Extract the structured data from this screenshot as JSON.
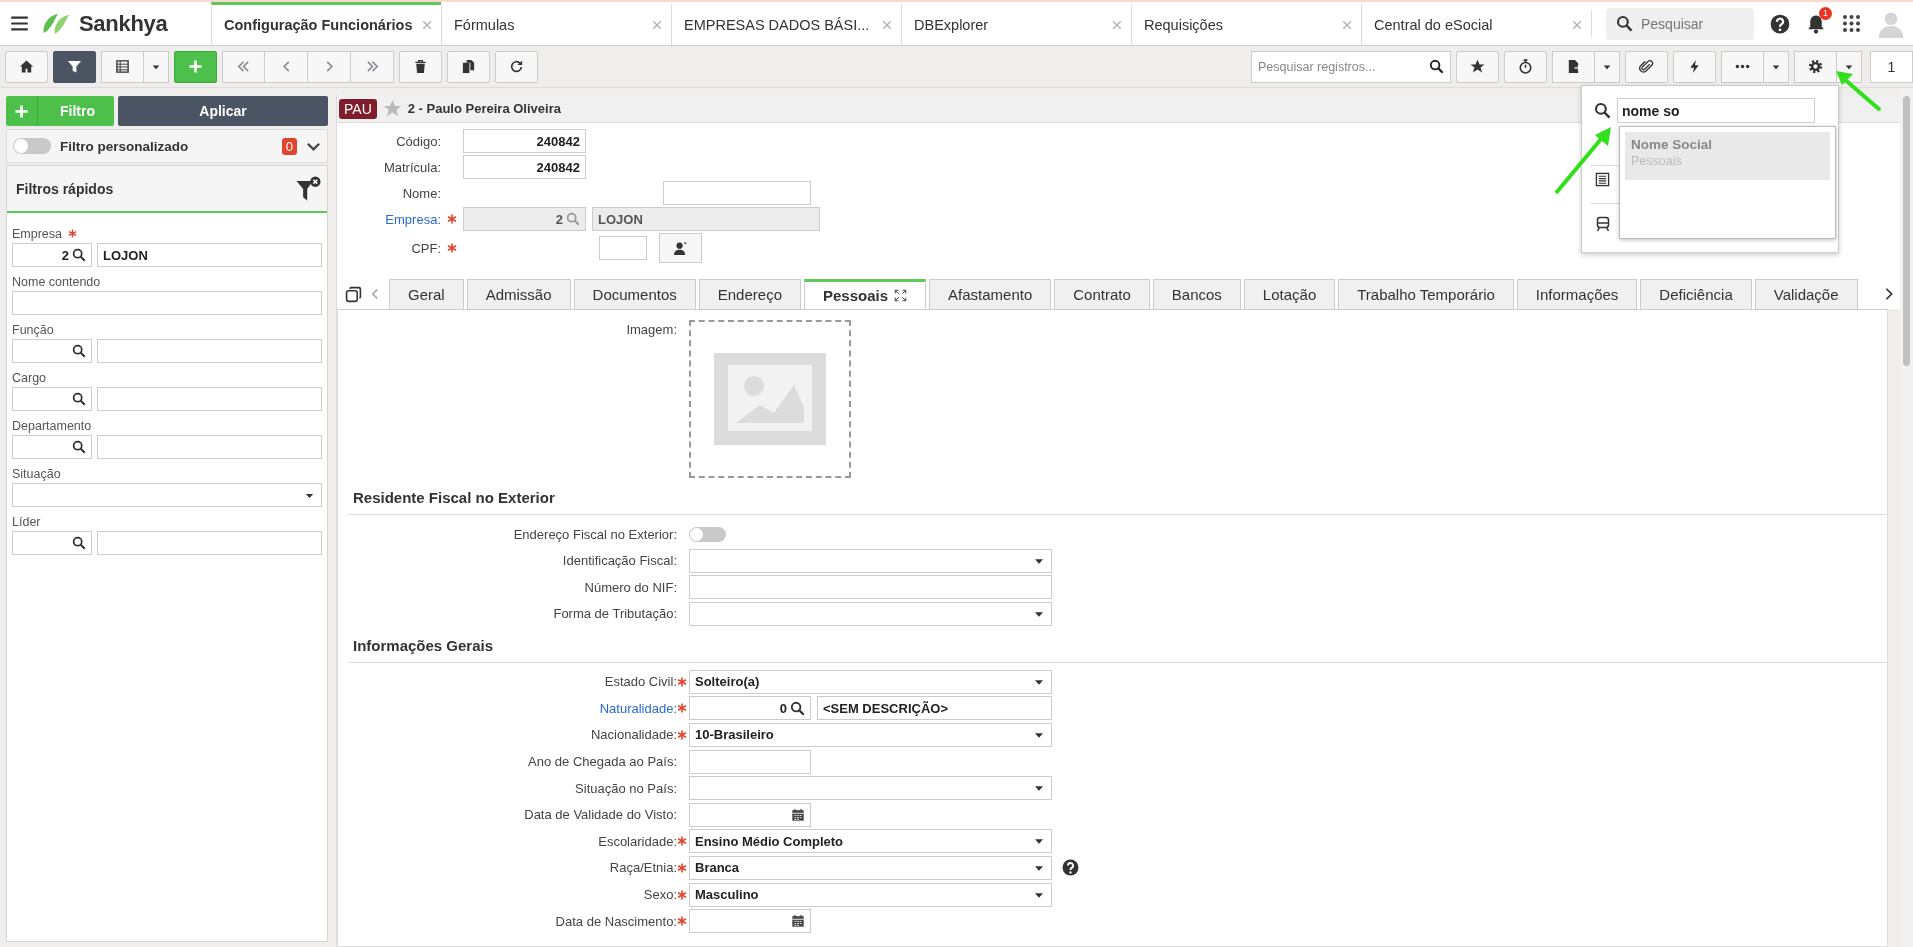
{
  "app_bar": {
    "logo": "Sankhya",
    "tabs": [
      {
        "label": "Configuração Funcionários",
        "selected": true
      },
      {
        "label": "Fórmulas",
        "selected": false
      },
      {
        "label": "EMPRESAS DADOS BÁSI...",
        "selected": false
      },
      {
        "label": "DBExplorer",
        "selected": false
      },
      {
        "label": "Requisições",
        "selected": false
      },
      {
        "label": "Central do eSocial",
        "selected": false
      }
    ],
    "search": {
      "placeholder": "Pesquisar"
    },
    "notification_count": "1"
  },
  "toolbar": {
    "search": {
      "placeholder": "Pesquisar registros..."
    },
    "page": "1"
  },
  "filter_panel": {
    "add_filter": "Filtro",
    "apply": "Aplicar",
    "custom_filter": {
      "label": "Filtro personalizado",
      "on": false,
      "count": "0"
    },
    "title": "Filtros rápidos",
    "fields": [
      {
        "kind": "lookup",
        "label": "Empresa",
        "required": true,
        "code": "2",
        "description": "LOJON"
      },
      {
        "kind": "text",
        "label": "Nome contendo"
      },
      {
        "kind": "lookup",
        "label": "Função"
      },
      {
        "kind": "lookup",
        "label": "Cargo"
      },
      {
        "kind": "lookup",
        "label": "Departamento"
      },
      {
        "kind": "select",
        "label": "Situação"
      },
      {
        "kind": "lookup",
        "label": "Líder"
      }
    ]
  },
  "record": {
    "badge": "PAU",
    "title": "2 - Paulo Pereira Oliveira",
    "fields": [
      {
        "kind": "number",
        "label": "Código:",
        "value": "240842"
      },
      {
        "kind": "number",
        "label": "Matrícula:",
        "value": "240842"
      },
      {
        "kind": "text",
        "label": "Nome:"
      },
      {
        "kind": "lookup",
        "label": "Empresa:",
        "required": true,
        "link": true,
        "code": "2",
        "description": "LOJON",
        "disabled": true
      },
      {
        "kind": "cpf",
        "label": "CPF:",
        "required": true
      }
    ]
  },
  "tabs": [
    {
      "label": "Geral",
      "selected": false
    },
    {
      "label": "Admissão",
      "selected": false
    },
    {
      "label": "Documentos",
      "selected": false
    },
    {
      "label": "Endereço",
      "selected": false
    },
    {
      "label": "Pessoais",
      "selected": true
    },
    {
      "label": "Afastamento",
      "selected": false
    },
    {
      "label": "Contrato",
      "selected": false
    },
    {
      "label": "Bancos",
      "selected": false
    },
    {
      "label": "Lotação",
      "selected": false
    },
    {
      "label": "Trabalho Temporário",
      "selected": false
    },
    {
      "label": "Informações",
      "selected": false
    },
    {
      "label": "Deficiência",
      "selected": false
    },
    {
      "label": "Validaçõe",
      "selected": false
    }
  ],
  "image_label": "Imagem:",
  "sections": [
    {
      "title": "Residente Fiscal no Exterior",
      "rows": [
        {
          "kind": "toggle",
          "label": "Endereço Fiscal no Exterior:",
          "on": false
        },
        {
          "kind": "select",
          "label": "Identificação Fiscal:"
        },
        {
          "kind": "text",
          "label": "Número do NIF:"
        },
        {
          "kind": "select",
          "label": "Forma de Tributação:"
        }
      ]
    },
    {
      "title": "Informações Gerais",
      "rows": [
        {
          "kind": "select",
          "label": "Estado Civil:",
          "required": true,
          "value": "Solteiro(a)"
        },
        {
          "kind": "lookup",
          "label": "Naturalidade:",
          "required": true,
          "link": true,
          "code": "0",
          "description": "<SEM DESCRIÇÃO>"
        },
        {
          "kind": "select",
          "label": "Nacionalidade:",
          "required": true,
          "value": "10-Brasileiro"
        },
        {
          "kind": "short",
          "label": "Ano de Chegada ao País:"
        },
        {
          "kind": "select",
          "label": "Situação no País:"
        },
        {
          "kind": "date",
          "label": "Data de Validade do Visto:"
        },
        {
          "kind": "select",
          "label": "Escolaridade:",
          "required": true,
          "value": "Ensino Médio Completo"
        },
        {
          "kind": "select",
          "label": "Raça/Etnia:",
          "required": true,
          "value": "Branca",
          "help": true
        },
        {
          "kind": "select",
          "label": "Sexo:",
          "required": true,
          "value": "Masculino"
        },
        {
          "kind": "date",
          "label": "Data de Nascimento:",
          "required": true
        }
      ]
    }
  ],
  "settings_menu": {
    "search_value": "nome so",
    "results": [
      {
        "title": "Nome Social",
        "subtitle": "Pessoais",
        "selected": true
      }
    ]
  }
}
